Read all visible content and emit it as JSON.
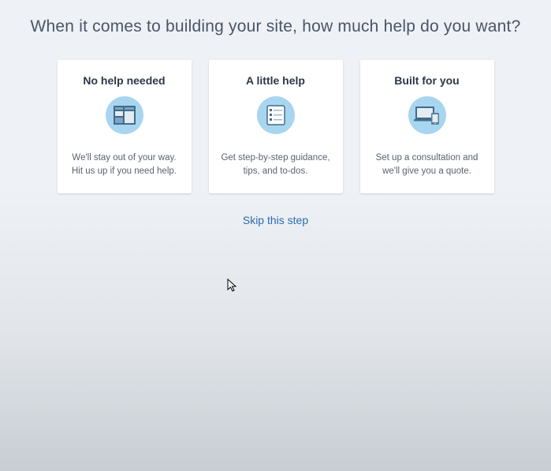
{
  "heading": "When it comes to building your site, how much help do you want?",
  "cards": [
    {
      "title": "No help needed",
      "description": "We'll stay out of your way. Hit us up if you need help."
    },
    {
      "title": "A little help",
      "description": "Get step-by-step guidance, tips, and to-dos."
    },
    {
      "title": "Built for you",
      "description": "Set up a consultation and we'll give you a quote."
    }
  ],
  "skip": "Skip this step",
  "colors": {
    "icon_bg": "#a8d5f0",
    "link": "#2b6cb0"
  }
}
